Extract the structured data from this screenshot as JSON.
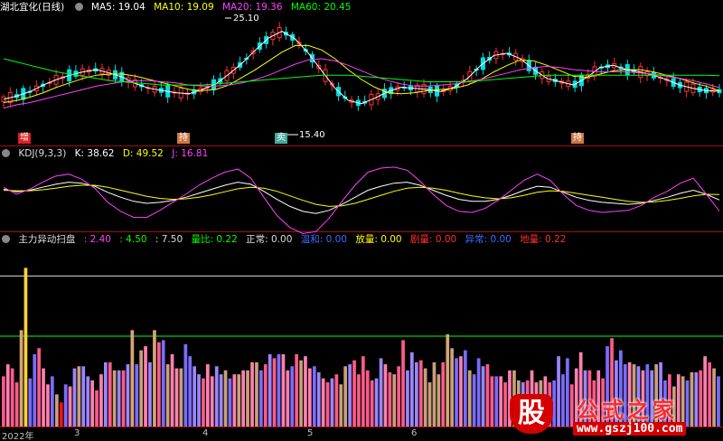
{
  "main_header": {
    "stock_name": "湖北宜化(日线)",
    "ma5": "MA5: 19.04",
    "ma10": "MA10: 19.09",
    "ma20": "MA20: 19.36",
    "ma60": "MA60: 20.45"
  },
  "kdj_header": {
    "name": "KDJ(9,3,3)",
    "k": "K: 38.62",
    "d": "D: 49.52",
    "j": "J: 16.81"
  },
  "scan_header": {
    "name": "主力异动扫盘",
    "v1": ": 2.40",
    "v2": ": 4.50",
    "v3": ": 7.50",
    "liangbi": "量比: 0.22",
    "zhengchang": "正常: 0.00",
    "wenliang": "温和: 0.00",
    "fangliang": "放量: 0.00",
    "juliang": "剧量: 0.00",
    "yichang": "异常: 0.00",
    "tianliang": "地量: 0.22"
  },
  "annotations": {
    "high_label": "25.10",
    "low_label": "15.40"
  },
  "signals": [
    "增",
    "持",
    "卖",
    "持"
  ],
  "x_labels": [
    "2022年",
    "3",
    "4",
    "5",
    "6"
  ],
  "watermark": {
    "badge": "股",
    "title": "公式之家",
    "url": "www.gszj100.com"
  },
  "colors": {
    "ma5": "#ffffff",
    "ma10": "#ffff00",
    "ma20": "#ff40ff",
    "ma60": "#00ff00",
    "up": "#ff3030",
    "down": "#00e0e0",
    "k": "#ffffff",
    "d": "#ffff00",
    "j": "#ff40ff",
    "separator": "#a01010"
  },
  "chart_data": [
    {
      "type": "line",
      "title": "湖北宜化(日线)",
      "ylim": [
        14.5,
        26.2
      ],
      "note_points": {
        "high": 25.1,
        "low": 15.4
      },
      "series": [
        {
          "name": "MA5",
          "values": [
            18.3,
            18.6,
            19.0,
            19.6,
            20.1,
            20.5,
            20.8,
            21.0,
            20.7,
            20.3,
            19.7,
            19.3,
            19.1,
            18.9,
            18.8,
            19.2,
            19.7,
            20.6,
            21.6,
            22.8,
            23.9,
            24.5,
            23.8,
            22.5,
            20.9,
            19.3,
            18.2,
            17.9,
            18.4,
            19.0,
            19.4,
            19.3,
            19.2,
            19.0,
            19.4,
            20.2,
            21.4,
            22.3,
            22.5,
            22.0,
            21.0,
            20.2,
            19.9,
            19.6,
            20.3,
            21.2,
            21.4,
            21.0,
            20.8,
            20.5,
            20.1,
            19.6,
            19.3,
            19.1,
            19.04
          ]
        },
        {
          "name": "MA10",
          "values": [
            18.0,
            18.2,
            18.5,
            18.9,
            19.4,
            19.8,
            20.2,
            20.5,
            20.6,
            20.6,
            20.4,
            20.1,
            19.8,
            19.5,
            19.2,
            19.1,
            19.2,
            19.6,
            20.3,
            21.0,
            21.8,
            22.6,
            23.2,
            23.2,
            22.8,
            22.0,
            21.0,
            20.1,
            19.4,
            18.9,
            18.8,
            18.9,
            19.1,
            19.2,
            19.3,
            19.6,
            20.1,
            20.8,
            21.4,
            21.9,
            21.8,
            21.4,
            20.9,
            20.4,
            20.3,
            20.6,
            20.9,
            21.0,
            21.0,
            20.8,
            20.5,
            20.2,
            19.8,
            19.5,
            19.09
          ]
        },
        {
          "name": "MA20",
          "values": [
            17.5,
            17.8,
            18.0,
            18.3,
            18.6,
            18.9,
            19.2,
            19.5,
            19.7,
            19.9,
            20.0,
            20.0,
            19.9,
            19.8,
            19.6,
            19.5,
            19.5,
            19.6,
            19.8,
            20.1,
            20.5,
            21.0,
            21.5,
            21.9,
            22.0,
            21.8,
            21.4,
            20.9,
            20.4,
            20.0,
            19.7,
            19.5,
            19.5,
            19.6,
            19.7,
            19.9,
            20.1,
            20.4,
            20.7,
            21.0,
            21.2,
            21.3,
            21.2,
            21.0,
            20.9,
            20.8,
            20.8,
            20.8,
            20.7,
            20.6,
            20.4,
            20.2,
            20.0,
            19.7,
            19.36
          ]
        },
        {
          "name": "MA60",
          "values": [
            22.0,
            21.7,
            21.4,
            21.1,
            20.8,
            20.6,
            20.4,
            20.2,
            20.0,
            19.9,
            19.8,
            19.7,
            19.6,
            19.6,
            19.6,
            19.6,
            19.7,
            19.8,
            19.9,
            20.0,
            20.1,
            20.2,
            20.3,
            20.4,
            20.5,
            20.5,
            20.5,
            20.4,
            20.3,
            20.2,
            20.1,
            20.0,
            19.9,
            19.9,
            19.9,
            19.9,
            20.0,
            20.1,
            20.2,
            20.3,
            20.4,
            20.5,
            20.5,
            20.5,
            20.5,
            20.5,
            20.5,
            20.5,
            20.5,
            20.5,
            20.5,
            20.5,
            20.5,
            20.5,
            20.45
          ]
        }
      ]
    },
    {
      "type": "line",
      "title": "KDJ(9,3,3)",
      "ylim": [
        -20,
        120
      ],
      "series": [
        {
          "name": "K",
          "values": [
            60,
            55,
            58,
            64,
            70,
            74,
            72,
            66,
            54,
            44,
            36,
            32,
            34,
            38,
            44,
            52,
            60,
            68,
            74,
            70,
            56,
            40,
            26,
            16,
            12,
            18,
            30,
            44,
            58,
            66,
            72,
            74,
            68,
            58,
            48,
            40,
            36,
            36,
            40,
            48,
            58,
            66,
            64,
            54,
            44,
            38,
            34,
            32,
            30,
            32,
            38,
            44,
            52,
            58,
            50,
            38.62
          ]
        },
        {
          "name": "D",
          "values": [
            58,
            57,
            57,
            59,
            62,
            66,
            68,
            68,
            64,
            58,
            52,
            46,
            42,
            40,
            41,
            44,
            49,
            55,
            61,
            64,
            62,
            56,
            47,
            38,
            30,
            26,
            27,
            32,
            40,
            48,
            56,
            62,
            64,
            62,
            58,
            52,
            47,
            43,
            41,
            43,
            48,
            54,
            57,
            56,
            52,
            48,
            44,
            40,
            36,
            34,
            35,
            38,
            42,
            47,
            50,
            49.52
          ]
        },
        {
          "name": "J",
          "values": [
            64,
            50,
            60,
            74,
            86,
            90,
            80,
            62,
            34,
            16,
            4,
            4,
            18,
            34,
            50,
            68,
            82,
            94,
            100,
            82,
            44,
            8,
            -16,
            -28,
            -24,
            2,
            36,
            68,
            94,
            102,
            104,
            98,
            76,
            50,
            28,
            16,
            14,
            22,
            38,
            58,
            78,
            90,
            78,
            50,
            28,
            18,
            14,
            16,
            18,
            28,
            44,
            56,
            72,
            82,
            50,
            16.81
          ]
        }
      ]
    },
    {
      "type": "bar",
      "title": "主力异动扫盘",
      "ylim": [
        0,
        9
      ],
      "reference_lines": [
        2.4,
        4.5,
        7.5
      ],
      "values": [
        2.5,
        3.1,
        2.9,
        2.2,
        4.8,
        7.9,
        2.4,
        3.6,
        3.9,
        2.9,
        2.1,
        2.5,
        1.6,
        1.2,
        2.1,
        2.0,
        2.9,
        3.0,
        3.0,
        2.5,
        2.3,
        1.8,
        2.6,
        3.2,
        3.2,
        2.8,
        2.8,
        2.8,
        3.1,
        4.8,
        3.1,
        3.8,
        4.0,
        3.2,
        4.8,
        4.2,
        4.3,
        3.1,
        3.6,
        2.9,
        2.9,
        4.1,
        3.5,
        3.0,
        2.6,
        2.4,
        3.1,
        2.5,
        3.0,
        2.6,
        2.8,
        2.4,
        2.6,
        2.6,
        2.8,
        2.8,
        3.2,
        3.2,
        2.8,
        3.1,
        3.6,
        3.4,
        3.6,
        3.6,
        2.8,
        3.0,
        3.6,
        3.3,
        3.5,
        2.9,
        3.0,
        2.7,
        2.4,
        2.2,
        2.4,
        2.6,
        2.1,
        3.0,
        3.1,
        3.3,
        2.6,
        3.5,
        2.8,
        2.3,
        2.4,
        3.4,
        3.1,
        2.7,
        2.6,
        3.0,
        4.3,
        2.8,
        3.7,
        3.2,
        3.3,
        2.9,
        2.2,
        3.2,
        2.6,
        3.2,
        4.6,
        3.9,
        3.4,
        3.5,
        3.8,
        2.8,
        2.6,
        3.4,
        3.0,
        3.1,
        2.5,
        2.5,
        2.5,
        2.2,
        2.8,
        2.8,
        2.3,
        2.2,
        2.3,
        2.8,
        2.2,
        2.3,
        2.5,
        2.2,
        2.3,
        3.5,
        2.6,
        3.4,
        2.1,
        2.9,
        3.7,
        2.8,
        2.8,
        2.3,
        2.8,
        2.4,
        4.0,
        4.4,
        3.3,
        3.8,
        3.1,
        3.2,
        3.1,
        3.0,
        2.8,
        3.1,
        2.8,
        3.1,
        3.2,
        2.3,
        2.6,
        2.0,
        2.6,
        2.5,
        2.3,
        2.7,
        2.7,
        2.8,
        3.5,
        3.2,
        2.9,
        2.5
      ]
    }
  ]
}
